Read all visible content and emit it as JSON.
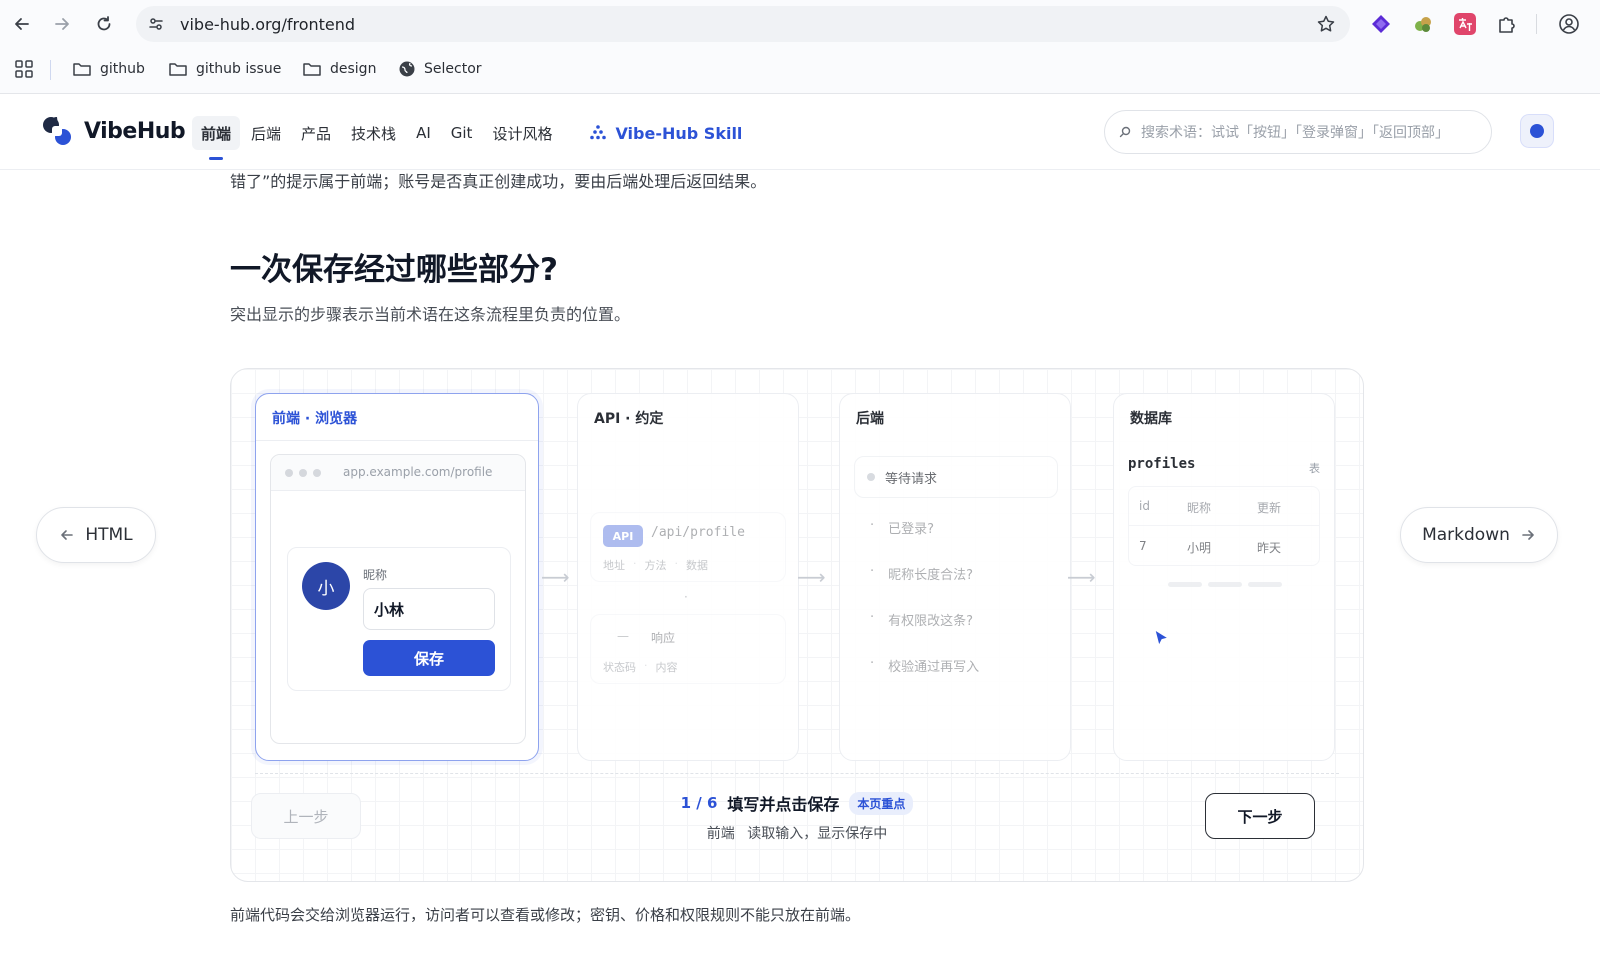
{
  "browser": {
    "url": "vibe-hub.org/frontend",
    "bookmarks": [
      {
        "label": "github"
      },
      {
        "label": "github issue"
      },
      {
        "label": "design"
      },
      {
        "label": "Selector"
      }
    ]
  },
  "header": {
    "logo_text": "VibeHub",
    "nav": [
      "前端",
      "后端",
      "产品",
      "技术栈",
      "AI",
      "Git",
      "设计风格"
    ],
    "active_nav": "前端",
    "skill_link": "Vibe-Hub Skill",
    "search_placeholder": "搜索术语：试试「按钮」「登录弹窗」「返回顶部」"
  },
  "content": {
    "cut_text": "错了”的提示属于前端；账号是否真正创建成功，要由后端处理后返回结果。",
    "section_title": "一次保存经过哪些部分?",
    "section_sub": "突出显示的步骤表示当前术语在这条流程里负责的位置。",
    "side_prev": "HTML",
    "side_next": "Markdown",
    "footer_note": "前端代码会交给浏览器运行，访问者可以查看或修改；密钥、价格和权限规则不能只放在前端。"
  },
  "flow": {
    "frontend": {
      "title": "前端 · 浏览器",
      "mock_url": "app.example.com/profile",
      "avatar": "小",
      "nick_label": "昵称",
      "nick_value": "小林",
      "save_button": "保存"
    },
    "api": {
      "title": "API · 约定",
      "badge": "API",
      "path": "/api/profile",
      "tags": [
        "地址",
        "方法",
        "数据"
      ],
      "dot": "·",
      "response_dash": "—",
      "response_label": "响应",
      "response_tags": [
        "状态码",
        "内容"
      ]
    },
    "backend": {
      "title": "后端",
      "waiting": "等待请求",
      "checks": [
        "已登录?",
        "昵称长度合法?",
        "有权限改这条?",
        "校验通过再写入"
      ]
    },
    "database": {
      "title": "数据库",
      "table_name": "profiles",
      "table_tag": "表",
      "columns": [
        "id",
        "昵称",
        "更新"
      ],
      "row": [
        "7",
        "小明",
        "昨天"
      ]
    },
    "controls": {
      "prev": "上一步",
      "next": "下一步",
      "step_count": "1 / 6",
      "step_title": "填写并点击保存",
      "badge": "本页重点",
      "desc_tag": "前端",
      "desc_text": "读取输入，显示保存中"
    }
  },
  "colors": {
    "accent": "#2c52d6",
    "avatar": "#2c46a8"
  }
}
